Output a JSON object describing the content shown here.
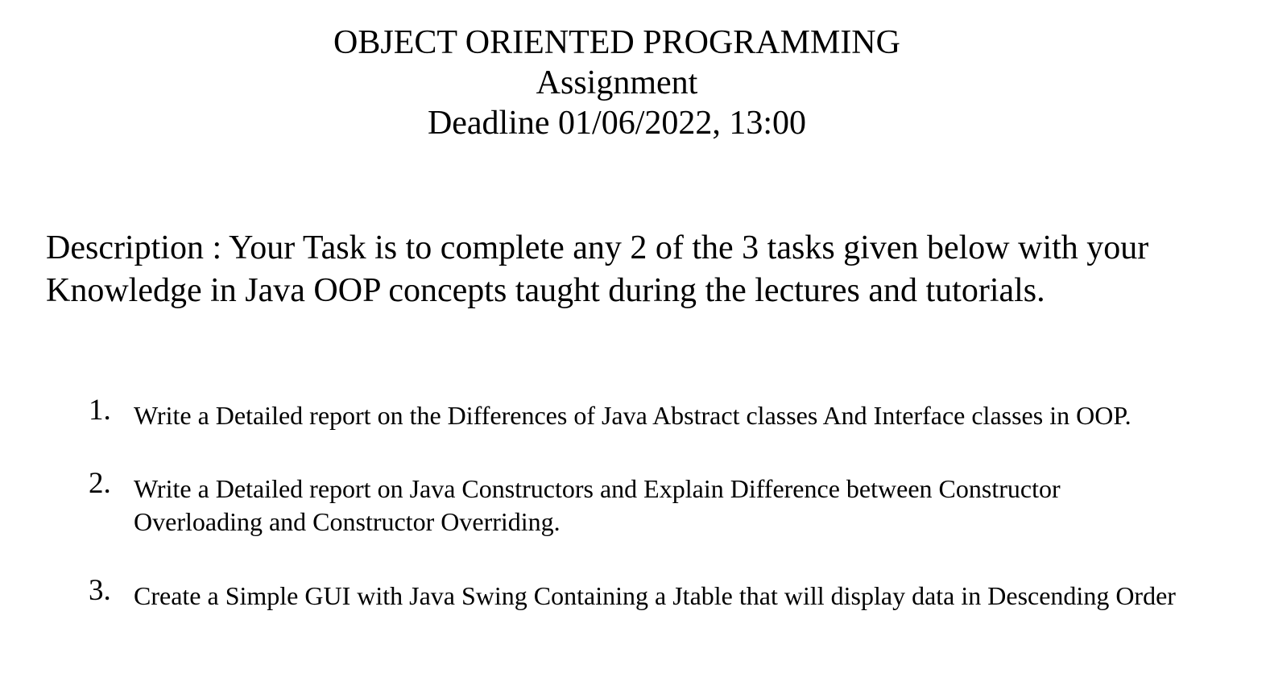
{
  "header": {
    "course_title": "OBJECT ORIENTED PROGRAMMING",
    "doc_type": "Assignment",
    "deadline": "Deadline 01/06/2022, 13:00"
  },
  "description": {
    "text": "Description : Your Task is to complete any 2 of the 3 tasks given below with your Knowledge in Java OOP concepts taught during the lectures and tutorials."
  },
  "tasks": [
    {
      "number": "1.",
      "text": "Write a Detailed report on the Differences of Java Abstract classes And Interface classes in OOP."
    },
    {
      "number": "2.",
      "text": "Write a Detailed report on Java Constructors and Explain Difference between Constructor Overloading and Constructor Overriding."
    },
    {
      "number": "3.",
      "text": "Create a Simple GUI with Java Swing Containing a Jtable that will display data in Descending Order"
    }
  ]
}
